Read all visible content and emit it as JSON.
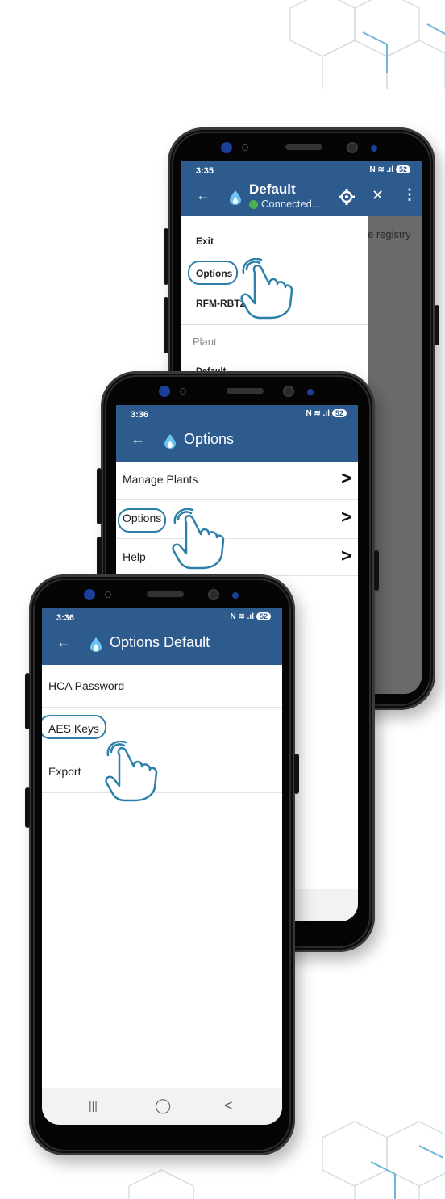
{
  "phone1": {
    "time": "3:35",
    "status_icons": "N ≋ .ıl",
    "battery": "52",
    "title": "Default",
    "subtitle": "Connected...",
    "bg_text": "e registry",
    "menu": {
      "exit": "Exit",
      "options": "Options",
      "device": "RFM-RBT2",
      "section": "Plant",
      "partial": "Default"
    }
  },
  "phone2": {
    "time": "3:36",
    "status_icons": "N ≋ .ıl",
    "battery": "52",
    "title": "Options",
    "rows": [
      {
        "label": "Manage Plants"
      },
      {
        "label": "Options"
      },
      {
        "label": "Help"
      }
    ]
  },
  "phone3": {
    "time": "3:36",
    "status_icons": "N ≋ .ıl",
    "battery": "52",
    "title": "Options Default",
    "rows": [
      {
        "label": "HCA Password"
      },
      {
        "label": "AES Keys"
      },
      {
        "label": "Export"
      }
    ],
    "nav": {
      "recents": "|||",
      "home": "◯",
      "back": "<"
    }
  },
  "icons": {
    "back": "arrow-left-icon",
    "chevron": "chevron-right-icon",
    "gear": "gear-icon",
    "close": "close-icon",
    "more": "more-vert-icon",
    "hand": "tap-hand-icon",
    "drop": "flame-drop-icon"
  },
  "colors": {
    "appbar": "#2d5b8e",
    "highlight": "#2b7fa8",
    "connected": "#4caf50"
  }
}
